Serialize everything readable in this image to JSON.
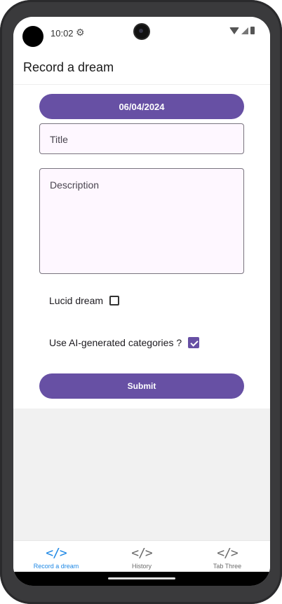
{
  "status": {
    "time": "10:02",
    "icons": [
      "gear-icon",
      "wifi-icon",
      "signal-icon",
      "battery-icon"
    ]
  },
  "appbar": {
    "title": "Record a dream"
  },
  "form": {
    "date_label": "06/04/2024",
    "title_placeholder": "Title",
    "description_placeholder": "Description",
    "lucid_label": "Lucid dream",
    "lucid_checked": false,
    "ai_label": "Use AI-generated categories ?",
    "ai_checked": true,
    "submit_label": "Submit"
  },
  "nav": {
    "tabs": [
      {
        "label": "Record a dream",
        "icon": "code-icon",
        "active": true
      },
      {
        "label": "History",
        "icon": "code-icon",
        "active": false
      },
      {
        "label": "Tab Three",
        "icon": "code-icon",
        "active": false
      }
    ]
  },
  "colors": {
    "primary": "#6750a4",
    "active_tab": "#1e88e5",
    "field_bg": "#fef7ff"
  }
}
